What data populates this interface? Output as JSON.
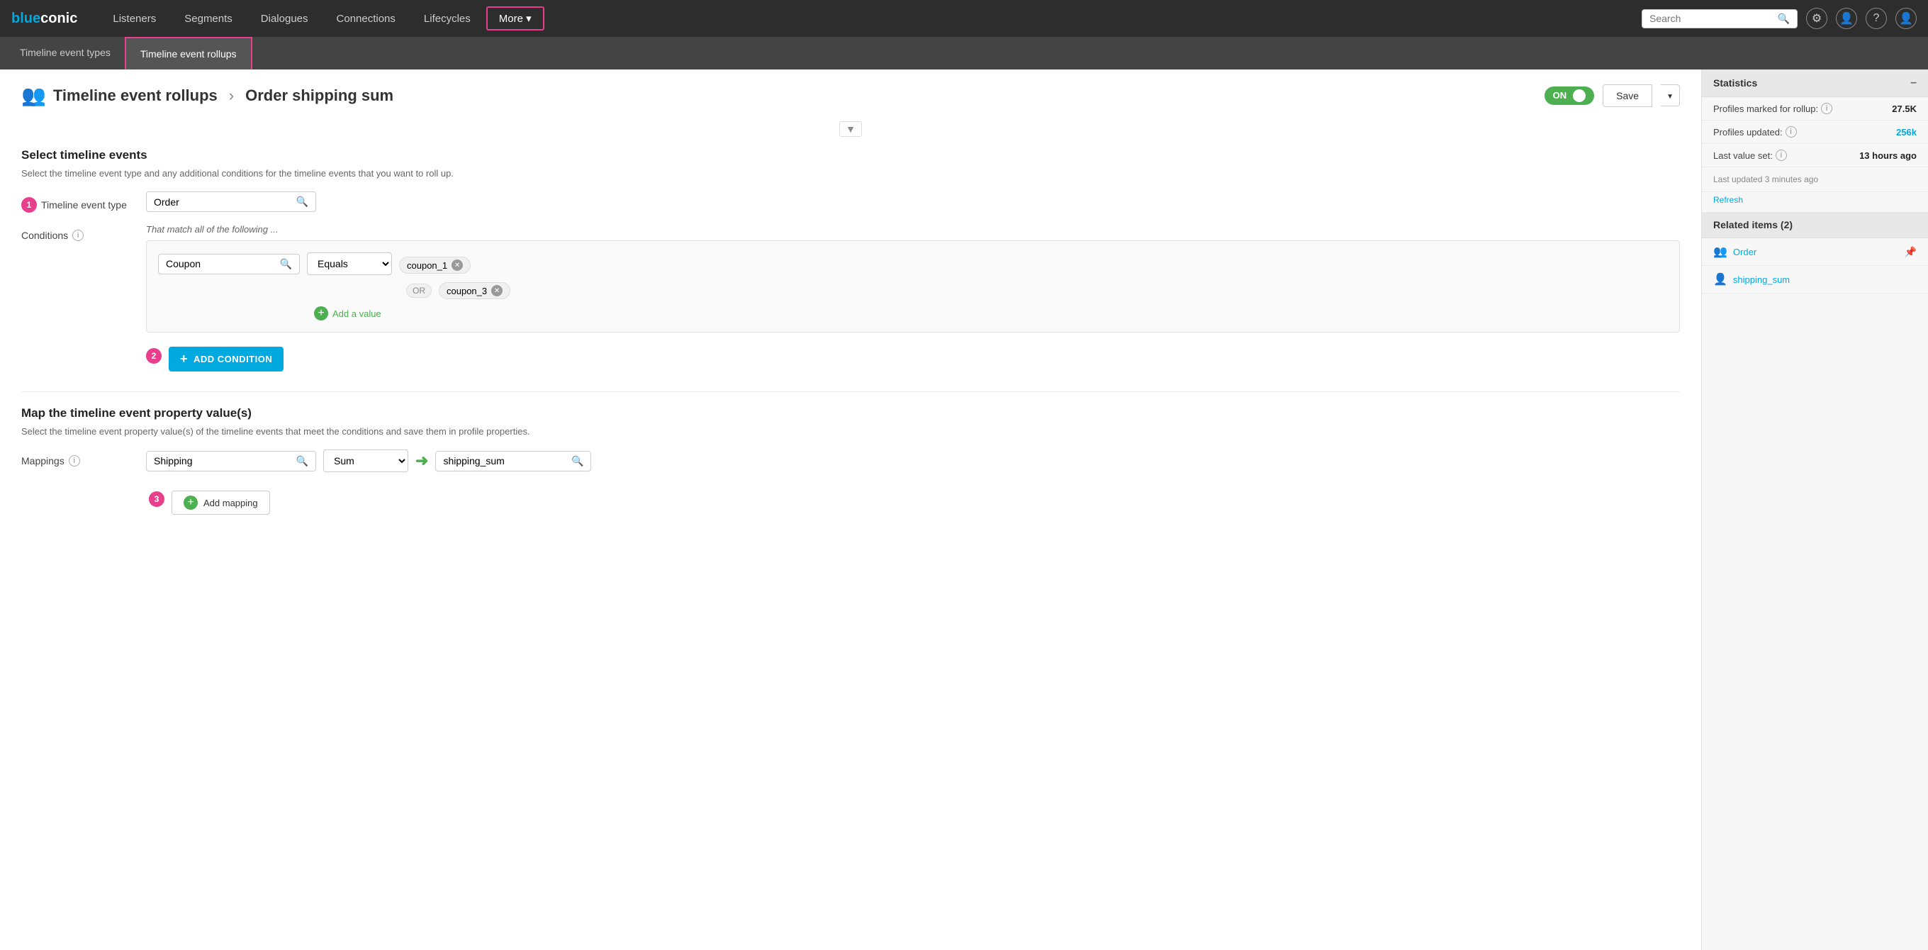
{
  "logo": {
    "blue": "blue",
    "conic": "conic"
  },
  "nav": {
    "items": [
      {
        "label": "Listeners",
        "key": "listeners"
      },
      {
        "label": "Segments",
        "key": "segments"
      },
      {
        "label": "Dialogues",
        "key": "dialogues"
      },
      {
        "label": "Connections",
        "key": "connections"
      },
      {
        "label": "Lifecycles",
        "key": "lifecycles"
      },
      {
        "label": "More ▾",
        "key": "more",
        "active": true
      }
    ],
    "search_placeholder": "Search"
  },
  "second_nav": {
    "items": [
      {
        "label": "Timeline event types",
        "key": "event-types"
      },
      {
        "label": "Timeline event rollups",
        "key": "event-rollups",
        "active": true
      }
    ]
  },
  "breadcrumb": {
    "parent": "Timeline event rollups",
    "separator": "›",
    "current": "Order shipping sum"
  },
  "toggle": {
    "label": "ON"
  },
  "buttons": {
    "save": "Save",
    "add_condition": "ADD CONDITION",
    "add_value": "Add a value",
    "add_mapping": "Add mapping",
    "refresh": "Refresh"
  },
  "chevron_down": "▼",
  "section1": {
    "title": "Select timeline events",
    "desc": "Select the timeline event type and any additional conditions for the timeline events that you want to roll up."
  },
  "timeline_event_type": {
    "label": "Timeline event type",
    "value": "Order",
    "step": "1"
  },
  "conditions": {
    "label": "Conditions",
    "match_text": "That match all of the following ...",
    "step": "2",
    "field": "Coupon",
    "operator": "Equals",
    "values": [
      "coupon_1",
      "coupon_3"
    ]
  },
  "section2": {
    "title": "Map the timeline event property value(s)",
    "desc": "Select the timeline event property value(s) of the timeline events that meet the conditions and save them in profile properties."
  },
  "mappings": {
    "label": "Mappings",
    "step": "3",
    "field": "Shipping",
    "operator": "Sum",
    "target": "shipping_sum"
  },
  "statistics": {
    "title": "Statistics",
    "profiles_marked_label": "Profiles marked for rollup:",
    "profiles_marked_value": "27.5K",
    "profiles_updated_label": "Profiles updated:",
    "profiles_updated_value": "256k",
    "last_value_label": "Last value set:",
    "last_value_value": "13 hours ago",
    "last_updated": "Last updated 3 minutes ago",
    "refresh": "Refresh"
  },
  "related": {
    "title": "Related items (2)",
    "items": [
      {
        "label": "Order",
        "type": "timeline"
      },
      {
        "label": "shipping_sum",
        "type": "profile"
      }
    ]
  }
}
